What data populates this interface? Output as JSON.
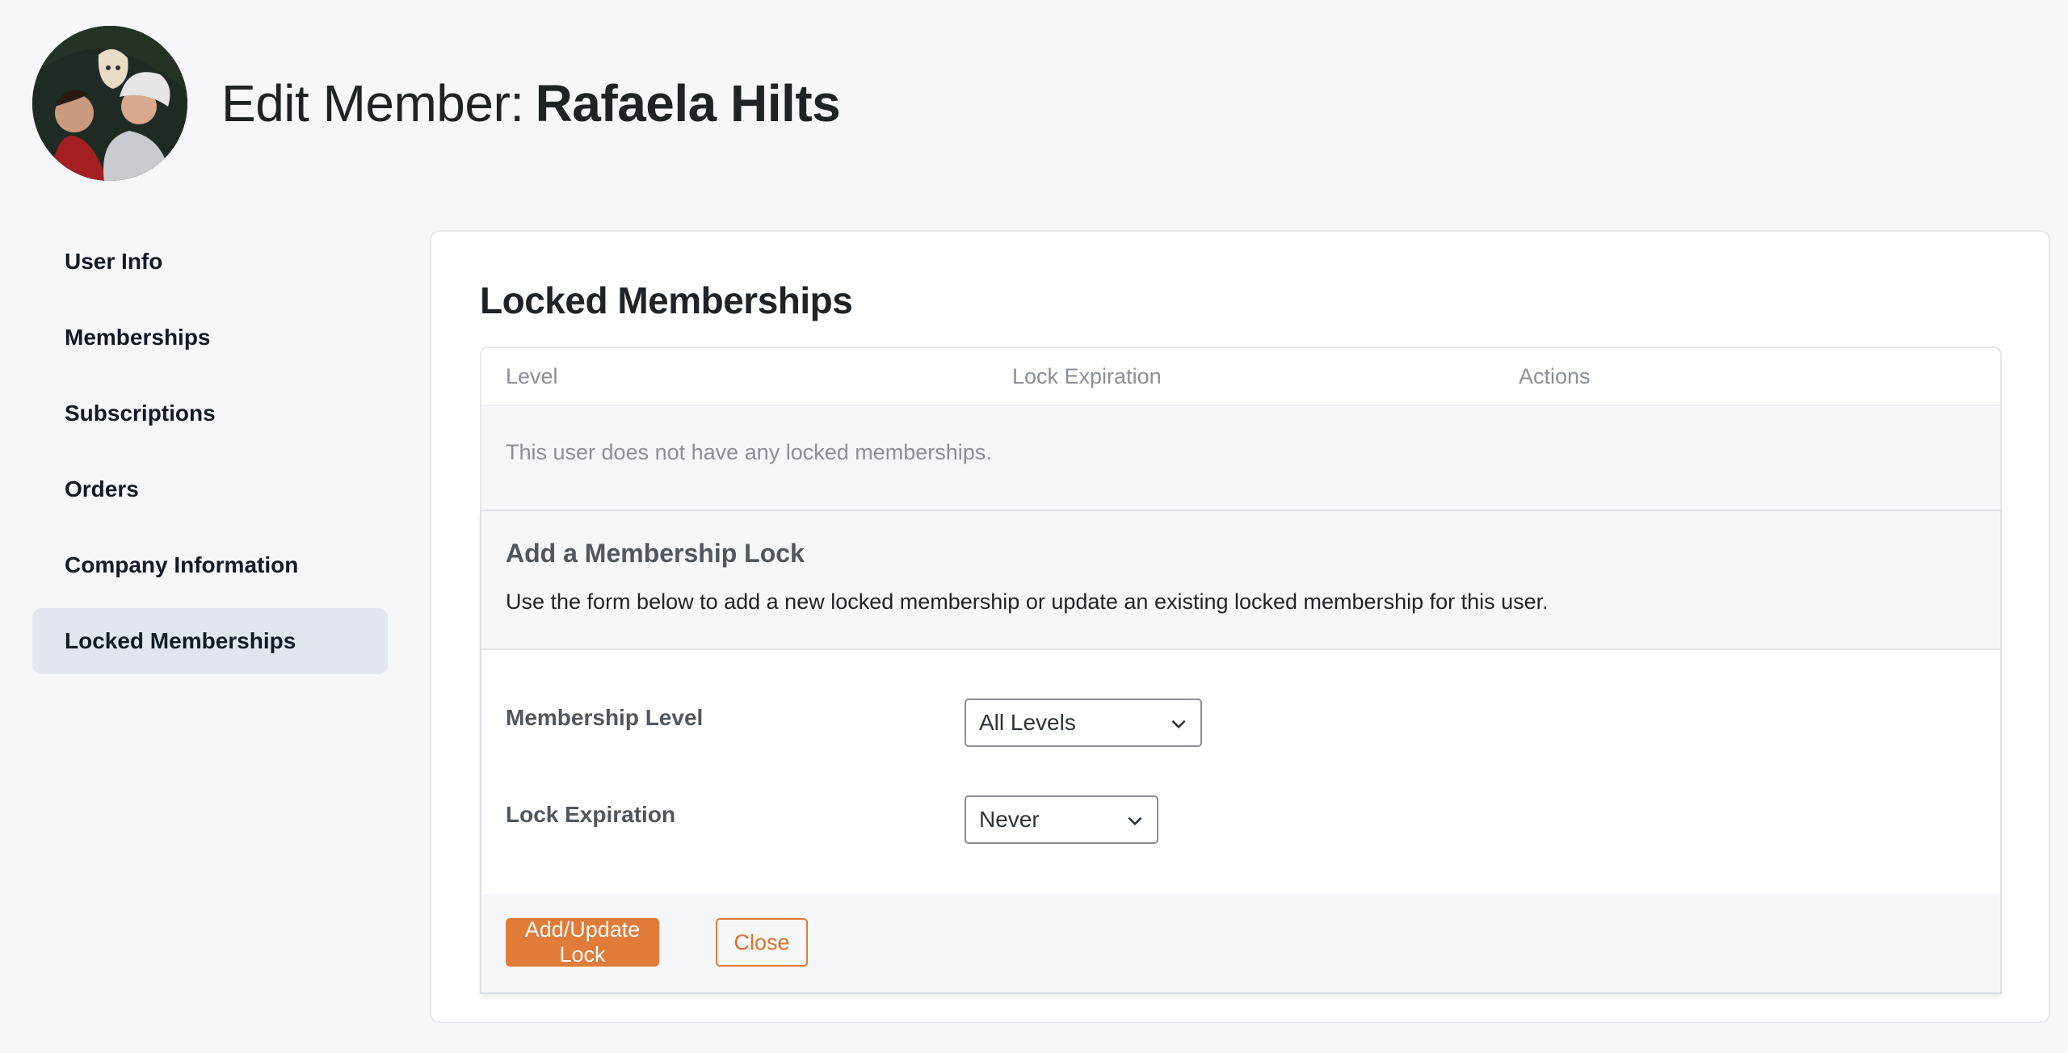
{
  "header": {
    "title_prefix": "Edit Member:",
    "member_name": "Rafaela Hilts",
    "avatar_alt": "member-avatar-photo"
  },
  "sidebar": {
    "items": [
      {
        "label": "User Info",
        "active": false
      },
      {
        "label": "Memberships",
        "active": false
      },
      {
        "label": "Subscriptions",
        "active": false
      },
      {
        "label": "Orders",
        "active": false
      },
      {
        "label": "Company Information",
        "active": false
      },
      {
        "label": "Locked Memberships",
        "active": true
      }
    ]
  },
  "main": {
    "section_title": "Locked Memberships",
    "table": {
      "columns": [
        "Level",
        "Lock Expiration",
        "Actions"
      ],
      "empty_message": "This user does not have any locked memberships."
    },
    "lock_form": {
      "title": "Add a Membership Lock",
      "description": "Use the form below to add a new locked membership or update an existing locked membership for this user.",
      "fields": [
        {
          "label": "Membership Level",
          "selected": "All Levels"
        },
        {
          "label": "Lock Expiration",
          "selected": "Never"
        }
      ],
      "submit_label": "Add/Update Lock",
      "close_label": "Close"
    }
  },
  "colors": {
    "accent": "#e07b39",
    "background": "#f6f7fb",
    "active_nav": "#e2e7ef"
  }
}
